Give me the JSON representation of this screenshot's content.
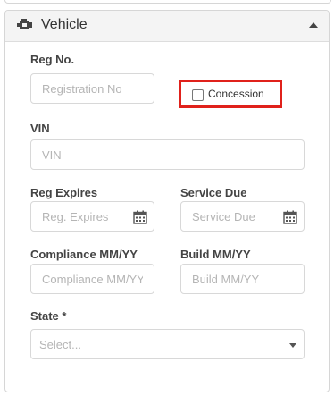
{
  "panel": {
    "title": "Vehicle",
    "header_icon": "engine-icon",
    "toggle_icon": "caret-up-icon"
  },
  "fields": {
    "reg_no": {
      "label": "Reg No.",
      "placeholder": "Registration No",
      "value": ""
    },
    "concession": {
      "label": "Concession",
      "checked": false,
      "highlight_color": "#e0211b"
    },
    "vin": {
      "label": "VIN",
      "placeholder": "VIN",
      "value": ""
    },
    "reg_expires": {
      "label": "Reg Expires",
      "placeholder": "Reg. Expires",
      "icon": "calendar-icon"
    },
    "service_due": {
      "label": "Service Due",
      "placeholder": "Service Due",
      "icon": "calendar-icon"
    },
    "compliance": {
      "label": "Compliance MM/YY",
      "placeholder": "Compliance MM/YY"
    },
    "build": {
      "label": "Build MM/YY",
      "placeholder": "Build MM/YY"
    },
    "state": {
      "label": "State *",
      "placeholder": "Select..."
    }
  }
}
